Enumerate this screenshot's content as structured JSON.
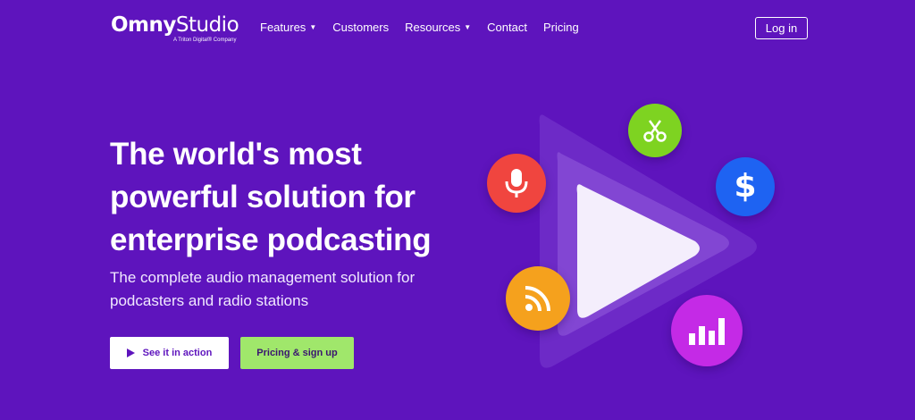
{
  "nav": {
    "logo": {
      "brand": "Omny",
      "product": "Studio",
      "tagline": "A Triton Digital® Company"
    },
    "items": [
      {
        "label": "Features",
        "has_dropdown": true
      },
      {
        "label": "Customers",
        "has_dropdown": false
      },
      {
        "label": "Resources",
        "has_dropdown": true
      },
      {
        "label": "Contact",
        "has_dropdown": false
      },
      {
        "label": "Pricing",
        "has_dropdown": false
      }
    ],
    "login_label": "Log in"
  },
  "hero": {
    "headline_lines": [
      "The world's most",
      "powerful solution for",
      "enterprise podcasting"
    ],
    "subline_lines": [
      "The complete audio management solution for",
      "podcasters and radio stations"
    ],
    "primary_button_label": "See it in action",
    "secondary_button_label": "Pricing & sign up"
  },
  "illustration": {
    "icons": [
      "microphone-icon",
      "scissors-icon",
      "dollar-icon",
      "rss-icon",
      "bar-chart-icon",
      "play-icon"
    ],
    "dollar_glyph": "$"
  },
  "colors": {
    "background": "#5e14bd",
    "accent_green": "#a0e76b",
    "mic_red": "#f0453f",
    "scissors_green": "#7ed321",
    "dollar_blue": "#1e63f2",
    "rss_orange": "#f5a11d",
    "chart_magenta": "#c42ae6"
  }
}
